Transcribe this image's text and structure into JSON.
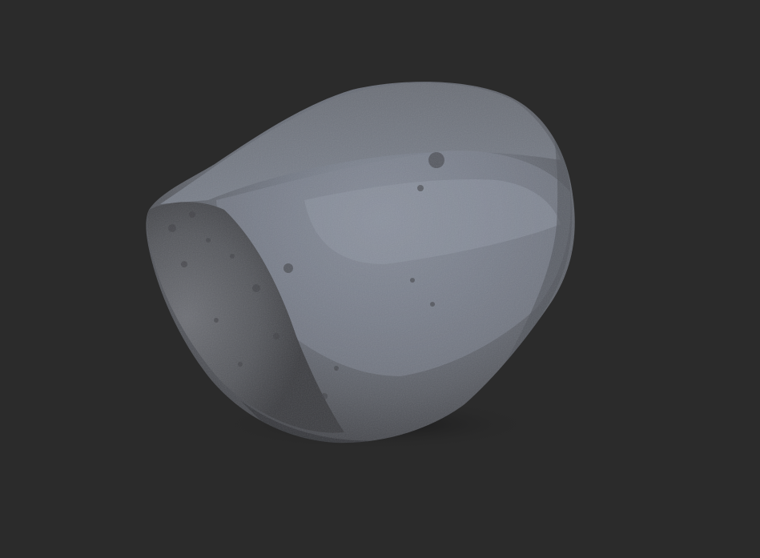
{
  "viewport": {
    "background_color": "#2b2b2b",
    "subject": "sculpted-rock-mesh",
    "material_colors": {
      "base": "#5f636c",
      "highlight": "#8a919d",
      "shadow": "#1f1f22",
      "rough_patch": "#4a4c52"
    }
  }
}
